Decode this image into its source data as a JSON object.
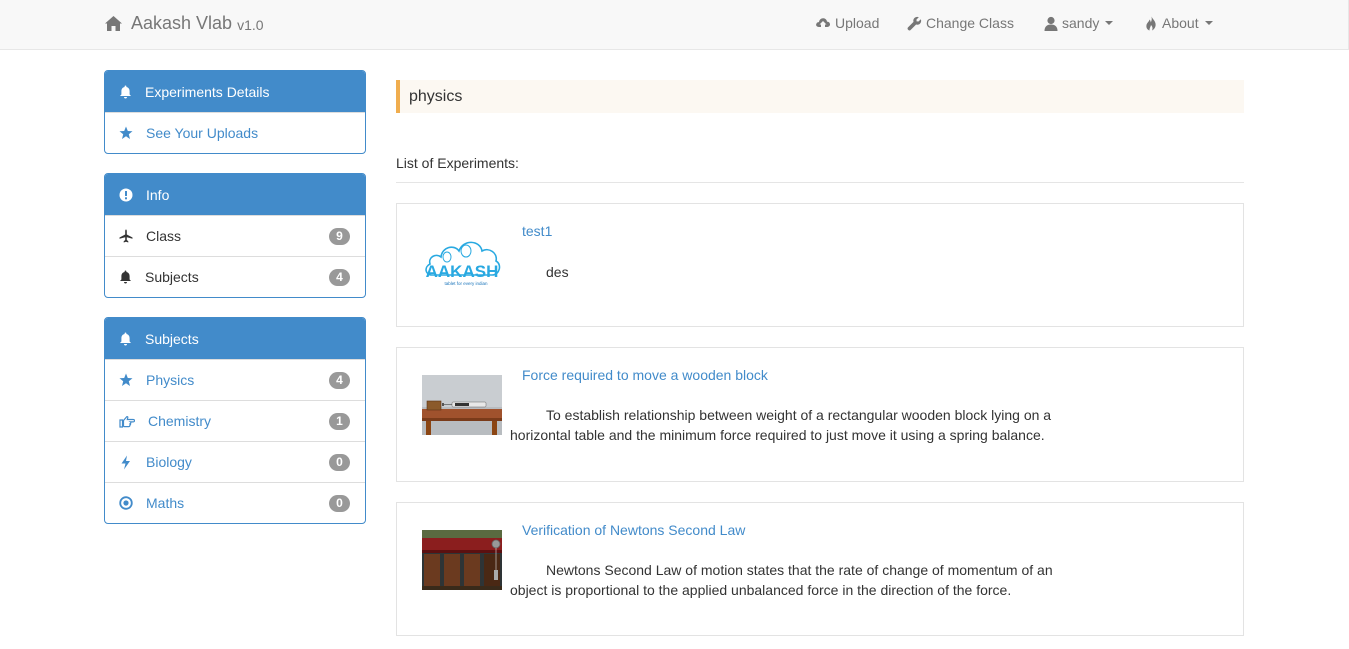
{
  "navbar": {
    "brand": "Aakash Vlab",
    "version": "v1.0",
    "items": [
      {
        "label": "Upload",
        "icon": "cloud-upload-icon"
      },
      {
        "label": "Change Class",
        "icon": "wrench-icon"
      },
      {
        "label": "sandy",
        "icon": "user-icon",
        "dropdown": true
      },
      {
        "label": "About",
        "icon": "fire-icon",
        "dropdown": true
      }
    ]
  },
  "sidebar": {
    "experiments": {
      "heading": "Experiments Details",
      "items": [
        {
          "label": "See Your Uploads",
          "icon": "star-icon"
        }
      ]
    },
    "info": {
      "heading": "Info",
      "items": [
        {
          "label": "Class",
          "count": "9",
          "icon": "plane-icon"
        },
        {
          "label": "Subjects",
          "count": "4",
          "icon": "bell-icon"
        }
      ]
    },
    "subjects": {
      "heading": "Subjects",
      "items": [
        {
          "label": "Physics",
          "count": "4",
          "icon": "star-icon"
        },
        {
          "label": "Chemistry",
          "count": "1",
          "icon": "hand-right-icon"
        },
        {
          "label": "Biology",
          "count": "0",
          "icon": "flash-icon"
        },
        {
          "label": "Maths",
          "count": "0",
          "icon": "record-icon"
        }
      ]
    }
  },
  "main": {
    "subject_title": "physics",
    "list_title": "List of Experiments:",
    "experiments": [
      {
        "title": "test1",
        "description": "des",
        "thumbnail": "aakash-logo"
      },
      {
        "title": "Force required to move a wooden block",
        "description": "To establish relationship between weight of a rectangular wooden block lying on a horizontal table and the minimum force required to just move it using a spring balance.",
        "thumbnail": "wooden-block-photo"
      },
      {
        "title": "Verification of Newtons Second Law",
        "description": "Newtons Second Law of motion states that the rate of change of momentum of an object is proportional to the applied unbalanced force in the direction of the force.",
        "thumbnail": "newtons-law-apparatus-photo"
      }
    ],
    "logo_text": "AAKASH",
    "logo_tagline": "tablet for every indian"
  },
  "colors": {
    "primary": "#428bca",
    "badge": "#999999",
    "subject_accent": "#f0ad4e",
    "subject_bg": "#fcf8f2",
    "navbar_bg": "#f8f8f8"
  }
}
